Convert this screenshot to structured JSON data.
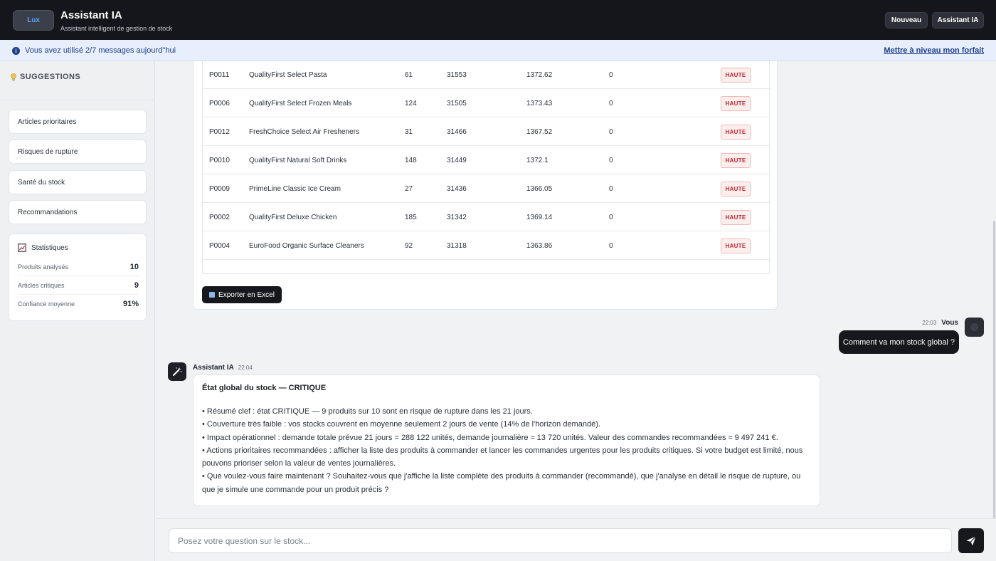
{
  "header": {
    "logo_text": "Lux",
    "title": "Assistant IA",
    "subtitle": "Assistant intelligent de gestion de stock",
    "btn_new": "Nouveau",
    "btn_assistant": "Assistant IA"
  },
  "banner": {
    "text": "Vous avez utilisé 2/7 messages aujourd''hui",
    "link": "Mettre à niveau mon forfait"
  },
  "sidebar": {
    "suggestions_title": "SUGGESTIONS",
    "suggestions": [
      "Articles prioritaires",
      "Risques de rupture",
      "Santé du stock",
      "Recommandations"
    ],
    "stats": {
      "title": "Statistiques",
      "rows": [
        {
          "label": "Produits analysés",
          "value": "10"
        },
        {
          "label": "Articles critiques",
          "value": "9"
        },
        {
          "label": "Confiance moyenne",
          "value": "91%"
        }
      ]
    }
  },
  "table": {
    "rows": [
      {
        "id": "P0011",
        "name": "QualityFirst Select Pasta",
        "qty": "61",
        "demand": "31553",
        "value": "1372.62",
        "stock": "0",
        "priority": "HAUTE"
      },
      {
        "id": "P0006",
        "name": "QualityFirst Select Frozen Meals",
        "qty": "124",
        "demand": "31505",
        "value": "1373.43",
        "stock": "0",
        "priority": "HAUTE"
      },
      {
        "id": "P0012",
        "name": "FreshChoice Select Air Fresheners",
        "qty": "31",
        "demand": "31466",
        "value": "1367.52",
        "stock": "0",
        "priority": "HAUTE"
      },
      {
        "id": "P0010",
        "name": "QualityFirst Natural Soft Drinks",
        "qty": "148",
        "demand": "31449",
        "value": "1372.1",
        "stock": "0",
        "priority": "HAUTE"
      },
      {
        "id": "P0009",
        "name": "PrimeLine Classic Ice Cream",
        "qty": "27",
        "demand": "31436",
        "value": "1366.05",
        "stock": "0",
        "priority": "HAUTE"
      },
      {
        "id": "P0002",
        "name": "QualityFirst Deluxe Chicken",
        "qty": "185",
        "demand": "31342",
        "value": "1369.14",
        "stock": "0",
        "priority": "HAUTE"
      },
      {
        "id": "P0004",
        "name": "EuroFood Organic Surface Cleaners",
        "qty": "92",
        "demand": "31318",
        "value": "1363.86",
        "stock": "0",
        "priority": "HAUTE"
      }
    ],
    "export_label": "Exporter en Excel"
  },
  "user_message": {
    "time": "22:03",
    "author": "Vous",
    "text": "Comment va mon stock global ?"
  },
  "ai_message": {
    "author": "Assistant IA",
    "time": "22:04",
    "title": "État global du stock — CRITIQUE",
    "lines": [
      "• Résumé clef : état CRITIQUE — 9 produits sur 10 sont en risque de rupture dans les 21 jours.",
      "• Couverture très faible : vos stocks couvrent en moyenne seulement 2 jours de vente (14% de l'horizon demandé).",
      "• Impact opérationnel : demande totale prévue 21 jours = 288 122 unités, demande journalière ≈ 13 720 unités. Valeur des commandes recommandées ≈ 9 497 241 €.",
      "• Actions prioritaires recommandées : afficher la liste des produits à commander et lancer les commandes urgentes pour les produits critiques. Si votre budget est limité, nous pouvons prioriser selon la valeur de ventes journalières.",
      "• Que voulez-vous faire maintenant ? Souhaitez-vous que j'affiche la liste complète des produits à commander (recommandé), que j'analyse en détail le risque de rupture, ou que je simule une commande pour un produit précis ?"
    ]
  },
  "composer": {
    "placeholder": "Posez votre question sur le stock..."
  },
  "colors": {
    "accent_dark": "#16181d",
    "badge_red": "#c0262d",
    "banner_blue": "#1e3e88"
  }
}
